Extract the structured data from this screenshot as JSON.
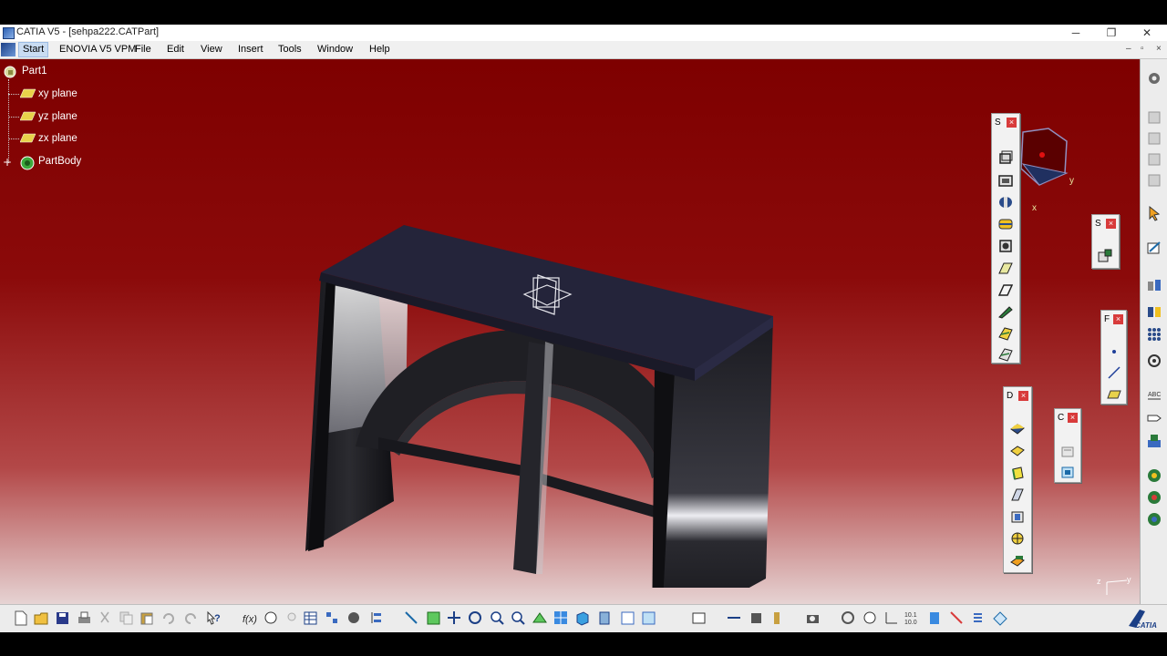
{
  "window": {
    "title": "CATIA V5 - [sehpa222.CATPart]",
    "minimize": "─",
    "restore": "❐",
    "close": "✕"
  },
  "menu": {
    "items": [
      "Start",
      "ENOVIA V5 VPM",
      "File",
      "Edit",
      "View",
      "Insert",
      "Tools",
      "Window",
      "Help"
    ],
    "mdi_min": "–",
    "mdi_restore": "▫",
    "mdi_close": "×"
  },
  "tree": {
    "root": "Part1",
    "items": [
      "xy plane",
      "yz plane",
      "zx plane",
      "PartBody"
    ]
  },
  "toolbars": {
    "sketch_based": {
      "label": "S",
      "close": "×"
    },
    "sketcher": {
      "label": "S",
      "close": "×"
    },
    "reference": {
      "label": "F",
      "close": "×"
    },
    "dress_up": {
      "label": "D",
      "close": "×"
    },
    "constraint": {
      "label": "C",
      "close": "×"
    }
  },
  "compass": {
    "x_label": "x",
    "y_label": "y"
  },
  "axis_triad": {
    "z": "z",
    "y": "y"
  },
  "bottom": {
    "scale_top": "10.1",
    "scale_bottom": "10.0",
    "brand": "CATIA"
  },
  "colors": {
    "background_top": "#7e0000",
    "background_bottom": "#e6d3d3",
    "model": "#1b1b22"
  }
}
